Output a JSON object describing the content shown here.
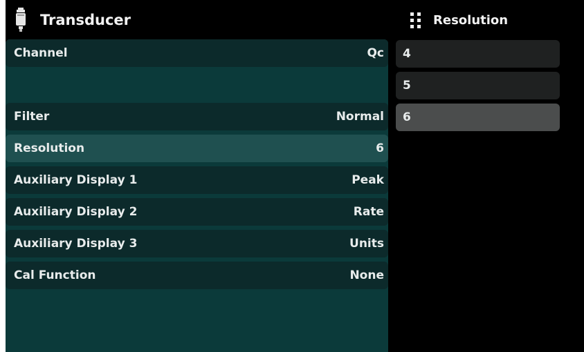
{
  "header": {
    "title": "Transducer",
    "icon": "transducer-icon"
  },
  "submenu": {
    "title": "Resolution",
    "icon": "grid-menu-icon"
  },
  "rows": [
    {
      "label": "Channel",
      "value": "Qc"
    },
    {
      "label": "",
      "value": ""
    },
    {
      "label": "Filter",
      "value": "Normal"
    },
    {
      "label": "Resolution",
      "value": "6"
    },
    {
      "label": "Auxiliary Display 1",
      "value": "Peak"
    },
    {
      "label": "Auxiliary Display 2",
      "value": "Rate"
    },
    {
      "label": "Auxiliary Display 3",
      "value": "Units"
    },
    {
      "label": "Cal Function",
      "value": "None"
    }
  ],
  "options": [
    {
      "label": "4"
    },
    {
      "label": "5"
    },
    {
      "label": "6"
    }
  ],
  "selected_option": "6",
  "colors": {
    "panel": "#0b3a3a",
    "row": "#0c2a2b",
    "row_selected": "#1f5050",
    "option": "#1f2121",
    "option_selected": "#4b4d4d"
  }
}
